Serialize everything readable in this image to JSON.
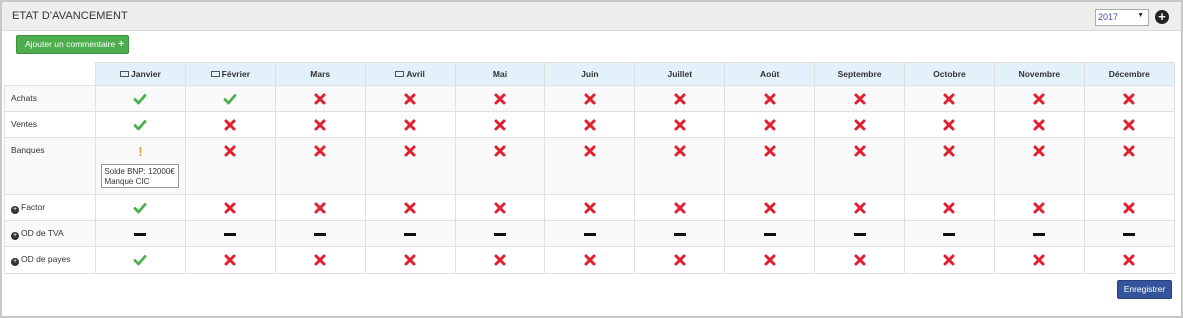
{
  "header": {
    "title": "ETAT D'AVANCEMENT",
    "year": "2017",
    "add_icon": "plus-circle-icon"
  },
  "toolbar": {
    "add_comment_label": "Ajouter un commentaire",
    "add_comment_icon": "plus-icon"
  },
  "months": [
    {
      "label": "Janvier",
      "calendar_icon": true
    },
    {
      "label": "Février",
      "calendar_icon": true
    },
    {
      "label": "Mars",
      "calendar_icon": false
    },
    {
      "label": "Avril",
      "calendar_icon": true
    },
    {
      "label": "Mai",
      "calendar_icon": false
    },
    {
      "label": "Juin",
      "calendar_icon": false
    },
    {
      "label": "Juillet",
      "calendar_icon": false
    },
    {
      "label": "Août",
      "calendar_icon": false
    },
    {
      "label": "Septembre",
      "calendar_icon": false
    },
    {
      "label": "Octobre",
      "calendar_icon": false
    },
    {
      "label": "Novembre",
      "calendar_icon": false
    },
    {
      "label": "Décembre",
      "calendar_icon": false
    }
  ],
  "rows": [
    {
      "label": "Achats",
      "expandable": false,
      "statuses": [
        "check",
        "check",
        "cross",
        "cross",
        "cross",
        "cross",
        "cross",
        "cross",
        "cross",
        "cross",
        "cross",
        "cross"
      ]
    },
    {
      "label": "Ventes",
      "expandable": false,
      "statuses": [
        "check",
        "cross",
        "cross",
        "cross",
        "cross",
        "cross",
        "cross",
        "cross",
        "cross",
        "cross",
        "cross",
        "cross"
      ]
    },
    {
      "label": "Banques",
      "expandable": false,
      "statuses": [
        "warning",
        "cross",
        "cross",
        "cross",
        "cross",
        "cross",
        "cross",
        "cross",
        "cross",
        "cross",
        "cross",
        "cross"
      ],
      "comment": "Solde BNP: 12000€\nManque CIC"
    },
    {
      "label": "Factor",
      "expandable": true,
      "statuses": [
        "check",
        "cross",
        "cross",
        "cross",
        "cross",
        "cross",
        "cross",
        "cross",
        "cross",
        "cross",
        "cross",
        "cross"
      ]
    },
    {
      "label": "OD de TVA",
      "expandable": true,
      "statuses": [
        "dash",
        "dash",
        "dash",
        "dash",
        "dash",
        "dash",
        "dash",
        "dash",
        "dash",
        "dash",
        "dash",
        "dash"
      ]
    },
    {
      "label": "OD de payes",
      "expandable": true,
      "statuses": [
        "check",
        "cross",
        "cross",
        "cross",
        "cross",
        "cross",
        "cross",
        "cross",
        "cross",
        "cross",
        "cross",
        "cross"
      ]
    }
  ],
  "footer": {
    "save_label": "Enregistrer"
  },
  "colors": {
    "check": "#4caf50",
    "cross": "#e02030",
    "dash": "#111111",
    "warning": "#f0a030",
    "header_bg": "#e3f1fa",
    "add_btn": "#4cae4c",
    "save_btn": "#34549c"
  }
}
